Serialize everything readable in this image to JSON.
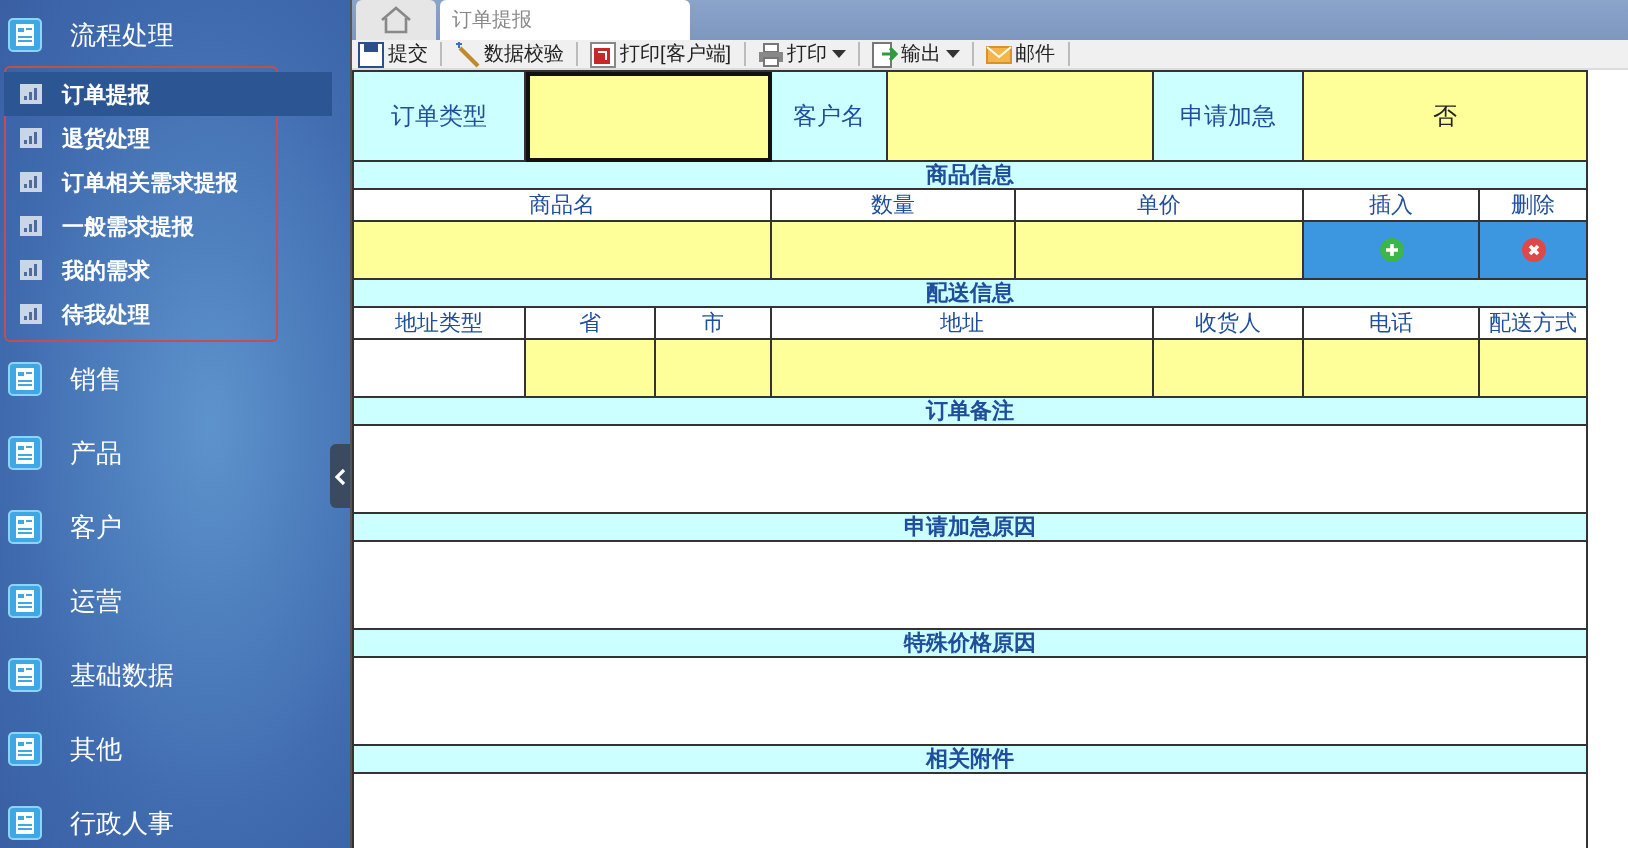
{
  "sidebar": {
    "groups": [
      {
        "label": "流程处理",
        "expanded": true,
        "items": [
          {
            "label": "订单提报",
            "selected": true
          },
          {
            "label": "退货处理",
            "selected": false
          },
          {
            "label": "订单相关需求提报",
            "selected": false
          },
          {
            "label": "一般需求提报",
            "selected": false
          },
          {
            "label": "我的需求",
            "selected": false
          },
          {
            "label": "待我处理",
            "selected": false
          }
        ]
      },
      {
        "label": "销售",
        "expanded": false
      },
      {
        "label": "产品",
        "expanded": false
      },
      {
        "label": "客户",
        "expanded": false
      },
      {
        "label": "运营",
        "expanded": false
      },
      {
        "label": "基础数据",
        "expanded": false
      },
      {
        "label": "其他",
        "expanded": false
      },
      {
        "label": "行政人事",
        "expanded": false
      }
    ]
  },
  "tabs": [
    {
      "label": "订单提报",
      "selected": true
    }
  ],
  "toolbar": [
    {
      "label": "提交",
      "kind": "save",
      "dropdown": false
    },
    {
      "label": "数据校验",
      "kind": "validate",
      "dropdown": false
    },
    {
      "label": "打印[客户端]",
      "kind": "pdf",
      "dropdown": false
    },
    {
      "label": "打印",
      "kind": "print",
      "dropdown": true
    },
    {
      "label": "输出",
      "kind": "export",
      "dropdown": true
    },
    {
      "label": "邮件",
      "kind": "mail",
      "dropdown": false
    }
  ],
  "form": {
    "fields": [
      {
        "label": "订单类型",
        "focused": true
      },
      {
        "label": "客户名",
        "focused": false
      },
      {
        "label": "申请加急",
        "value": "否",
        "focused": false
      }
    ],
    "sections": [
      {
        "title": "商品信息",
        "kind": "table",
        "columns": [
          {
            "label": "商品名",
            "kind": "input"
          },
          {
            "label": "数量",
            "kind": "input"
          },
          {
            "label": "单价",
            "kind": "input"
          },
          {
            "label": "插入",
            "kind": "insert"
          },
          {
            "label": "删除",
            "kind": "delete"
          }
        ]
      },
      {
        "title": "配送信息",
        "kind": "table",
        "columns": [
          {
            "label": "地址类型",
            "kind": "plain"
          },
          {
            "label": "省",
            "kind": "input"
          },
          {
            "label": "市",
            "kind": "input"
          },
          {
            "label": "地址",
            "kind": "input"
          },
          {
            "label": "收货人",
            "kind": "input"
          },
          {
            "label": "电话",
            "kind": "input"
          },
          {
            "label": "配送方式",
            "kind": "input"
          }
        ]
      },
      {
        "title": "订单备注",
        "kind": "text"
      },
      {
        "title": "申请加急原因",
        "kind": "text"
      },
      {
        "title": "特殊价格原因",
        "kind": "text"
      },
      {
        "title": "相关附件",
        "kind": "text"
      }
    ]
  }
}
